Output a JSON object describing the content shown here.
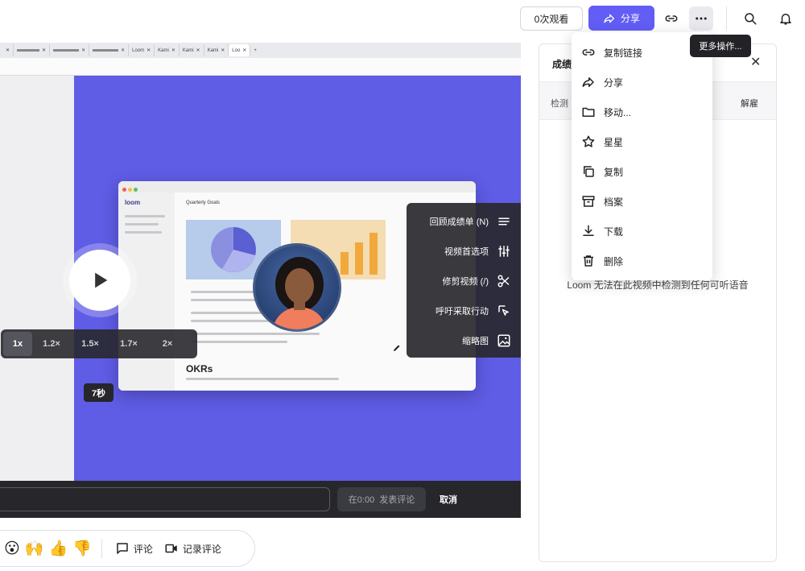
{
  "header": {
    "views_label": "0次观看",
    "share_label": "分享",
    "more_tooltip": "更多操作..."
  },
  "dropdown": {
    "items": [
      {
        "label": "复制链接",
        "icon": "link-icon"
      },
      {
        "label": "分享",
        "icon": "share-icon"
      },
      {
        "label": "移动...",
        "icon": "folder-icon"
      },
      {
        "label": "星星",
        "icon": "star-icon"
      },
      {
        "label": "复制",
        "icon": "duplicate-icon"
      },
      {
        "label": "档案",
        "icon": "archive-icon"
      },
      {
        "label": "下载",
        "icon": "download-icon"
      },
      {
        "label": "删除",
        "icon": "trash-icon"
      }
    ]
  },
  "browser": {
    "tabs": [
      "",
      "",
      "",
      "",
      "Loom",
      "Kami",
      "Kami",
      "Kami",
      "Loo"
    ]
  },
  "video": {
    "inner_logo": "loom",
    "inner_title": "Quarterly Goals",
    "okr_heading": "OKRs",
    "speeds": [
      "1x",
      "1.2×",
      "1.5×",
      "1.7×",
      "2×"
    ],
    "selected_speed": "1x",
    "seconds_badge": "7秒",
    "side_menu": [
      {
        "label": "回顾成绩单 (N)",
        "icon": "list-icon"
      },
      {
        "label": "视频首选项",
        "icon": "sliders-icon"
      },
      {
        "label": "修剪视频 (/)",
        "icon": "scissors-icon"
      },
      {
        "label": "呼吁采取行动",
        "icon": "cursor-icon"
      },
      {
        "label": "缩略图",
        "icon": "image-icon"
      }
    ]
  },
  "comment": {
    "post_time": "在0:00",
    "post_label": "发表评论",
    "cancel_label": "取消"
  },
  "reactions": {
    "emojis": [
      "😮",
      "🙌",
      "👍",
      "👎"
    ],
    "comment_label": "评论",
    "record_label": "记录评论"
  },
  "transcript": {
    "title": "成绩",
    "sub_left": "检测",
    "sub_right": "解雇",
    "message": "Loom 无法在此视频中检测到任何可听语音"
  },
  "colors": {
    "accent": "#625df5",
    "video_bg": "#5f5ce6",
    "dark_overlay": "#28282e"
  }
}
